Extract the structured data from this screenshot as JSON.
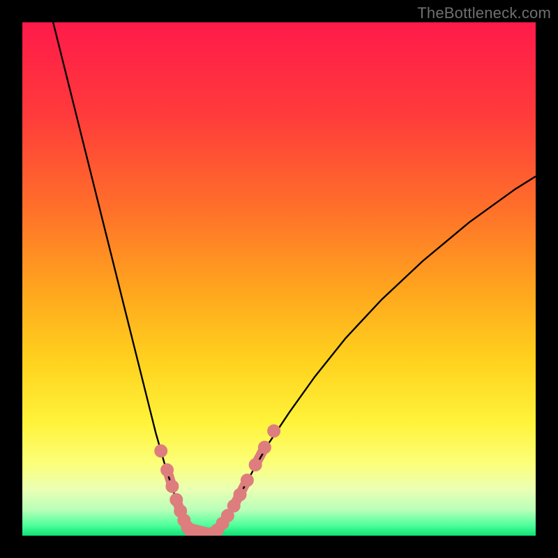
{
  "watermark": "TheBottleneck.com",
  "colors": {
    "background": "#000000",
    "gradient_stops": [
      {
        "offset": 0.0,
        "color": "#ff1a4a"
      },
      {
        "offset": 0.18,
        "color": "#ff3b3b"
      },
      {
        "offset": 0.36,
        "color": "#ff6f2a"
      },
      {
        "offset": 0.52,
        "color": "#ffa51e"
      },
      {
        "offset": 0.66,
        "color": "#ffd21e"
      },
      {
        "offset": 0.78,
        "color": "#fff33a"
      },
      {
        "offset": 0.86,
        "color": "#fcff7a"
      },
      {
        "offset": 0.91,
        "color": "#eaffb4"
      },
      {
        "offset": 0.95,
        "color": "#b9ffb9"
      },
      {
        "offset": 0.98,
        "color": "#4dff9a"
      },
      {
        "offset": 1.0,
        "color": "#10e176"
      }
    ],
    "curve": "#000000",
    "marker_fill": "#de7d7d",
    "marker_stroke": "#de7d7d"
  },
  "chart_data": {
    "type": "line",
    "title": "",
    "xlabel": "",
    "ylabel": "",
    "xlim": [
      0,
      100
    ],
    "ylim": [
      0,
      100
    ],
    "grid": false,
    "legend": false,
    "series": [
      {
        "name": "left-branch",
        "x": [
          6,
          8,
          10,
          12,
          14,
          16,
          18,
          20,
          22,
          23.5,
          25,
          26,
          27,
          28,
          29,
          29.8,
          30.5,
          31.2,
          31.8,
          32.3,
          32.8
        ],
        "y": [
          100,
          92,
          84,
          76,
          68,
          60,
          52,
          44,
          36,
          30,
          24,
          20,
          16.5,
          13,
          10,
          7.5,
          5.3,
          3.6,
          2.3,
          1.2,
          0.5
        ]
      },
      {
        "name": "valley-floor",
        "x": [
          32.8,
          33.5,
          34.5,
          35.5,
          36.5,
          37.2
        ],
        "y": [
          0.5,
          0.1,
          0,
          0,
          0.1,
          0.4
        ]
      },
      {
        "name": "right-branch",
        "x": [
          37.2,
          38,
          39,
          40,
          41.5,
          43,
          45,
          48,
          52,
          57,
          63,
          70,
          78,
          87,
          96,
          100
        ],
        "y": [
          0.4,
          1.1,
          2.4,
          3.9,
          6.3,
          9.1,
          12.8,
          18.0,
          24.0,
          31.0,
          38.5,
          46.0,
          53.5,
          61.0,
          67.5,
          70.0
        ]
      }
    ],
    "markers": {
      "name": "highlight-dots",
      "points": [
        {
          "x": 27.0,
          "y": 16.5
        },
        {
          "x": 28.2,
          "y": 12.8
        },
        {
          "x": 29.2,
          "y": 9.6
        },
        {
          "x": 30.0,
          "y": 7.0
        },
        {
          "x": 30.8,
          "y": 4.8
        },
        {
          "x": 31.5,
          "y": 3.0
        },
        {
          "x": 32.2,
          "y": 1.6
        },
        {
          "x": 33.0,
          "y": 0.6
        },
        {
          "x": 34.0,
          "y": 0.1
        },
        {
          "x": 35.0,
          "y": 0.0
        },
        {
          "x": 36.0,
          "y": 0.1
        },
        {
          "x": 37.0,
          "y": 0.4
        },
        {
          "x": 38.0,
          "y": 1.1
        },
        {
          "x": 39.0,
          "y": 2.4
        },
        {
          "x": 40.0,
          "y": 3.9
        },
        {
          "x": 41.2,
          "y": 5.8
        },
        {
          "x": 42.4,
          "y": 8.0
        },
        {
          "x": 43.8,
          "y": 10.8
        },
        {
          "x": 45.4,
          "y": 13.8
        },
        {
          "x": 47.2,
          "y": 17.2
        },
        {
          "x": 49.0,
          "y": 20.4
        }
      ],
      "radius": 9
    },
    "connectors": {
      "name": "highlight-connectors",
      "segments": [
        {
          "x1": 28.2,
          "y1": 12.8,
          "x2": 29.2,
          "y2": 9.6
        },
        {
          "x1": 30.0,
          "y1": 7.0,
          "x2": 30.8,
          "y2": 4.8
        },
        {
          "x1": 32.2,
          "y1": 1.6,
          "x2": 37.0,
          "y2": 0.4
        },
        {
          "x1": 39.0,
          "y1": 2.4,
          "x2": 40.0,
          "y2": 3.9
        },
        {
          "x1": 41.2,
          "y1": 5.8,
          "x2": 43.8,
          "y2": 10.8
        },
        {
          "x1": 45.4,
          "y1": 13.8,
          "x2": 47.2,
          "y2": 17.2
        }
      ],
      "width": 14
    }
  }
}
